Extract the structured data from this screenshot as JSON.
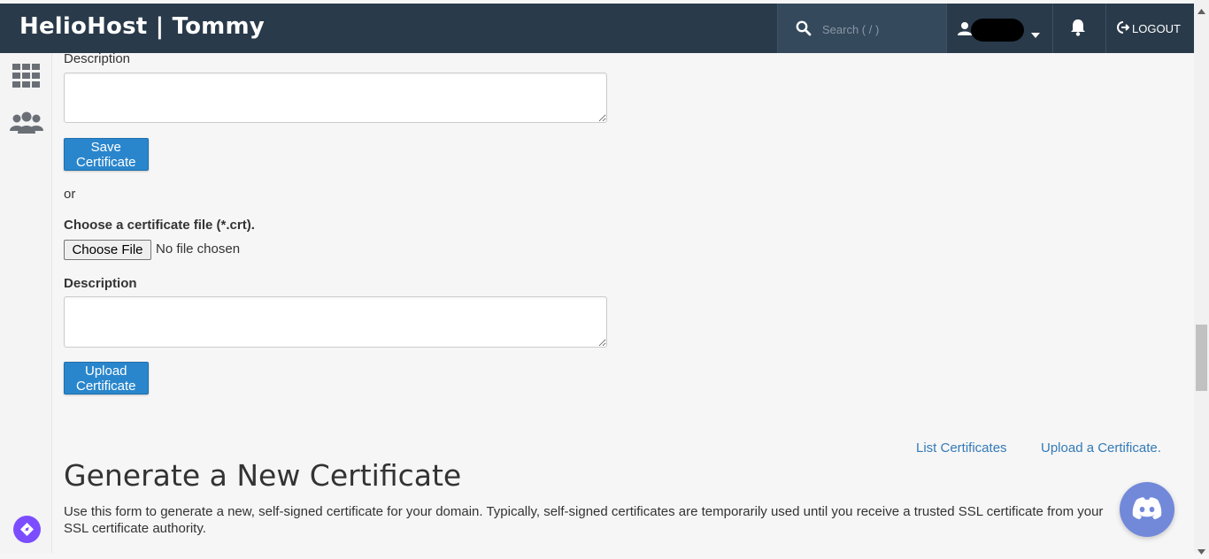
{
  "header": {
    "brand": "HelioHost | Tommy",
    "search_placeholder": "Search ( / )",
    "logout_label": "LOGOUT"
  },
  "form": {
    "description_label_1": "Description",
    "save_button": "Save Certificate",
    "or_text": "or",
    "choose_file_label": "Choose a certificate file (*.crt).",
    "choose_file_button": "Choose File",
    "no_file_text": "No file chosen",
    "description_label_2": "Description",
    "upload_button": "Upload Certificate"
  },
  "links": {
    "list_certificates": "List Certificates",
    "upload_certificate": "Upload a Certificate."
  },
  "generate": {
    "title": "Generate a New Certificate",
    "description": "Use this form to generate a new, self-signed certificate for your domain. Typically, self-signed certificates are temporarily used until you receive a trusted SSL certificate from your SSL certificate authority."
  },
  "colors": {
    "header_bg": "#293a4a",
    "primary_button": "#2a86cc",
    "link": "#337ab7",
    "discord": "#7289da",
    "launcher": "#7c4dff"
  },
  "icons": [
    "search-icon",
    "user-icon",
    "caret-down-icon",
    "bell-icon",
    "logout-icon",
    "grid-icon",
    "users-icon",
    "discord-icon",
    "compass-icon"
  ]
}
